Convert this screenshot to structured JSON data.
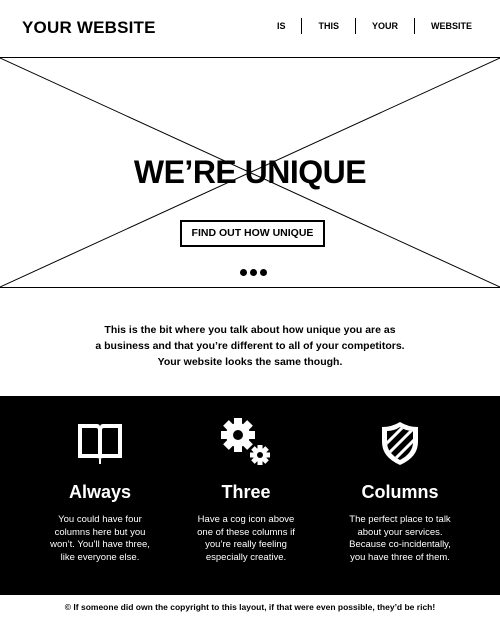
{
  "header": {
    "logo": "YOUR WEBSITE",
    "nav": [
      "IS",
      "THIS",
      "YOUR",
      "WEBSITE"
    ]
  },
  "hero": {
    "title": "WE’RE UNIQUE",
    "cta": "FIND OUT HOW UNIQUE",
    "slide_dots": 3
  },
  "intro": {
    "lines": [
      "This is the bit where you talk about how unique you are as",
      "a business and that you’re different to all of your competitors.",
      "Your website looks the same though."
    ]
  },
  "features": {
    "background": "#000000",
    "columns": [
      {
        "icon": "book-icon",
        "title": "Always",
        "lines": [
          "You could have four",
          "columns here but you",
          "won’t. You’ll have three,",
          "like everyone else."
        ]
      },
      {
        "icon": "cogs-icon",
        "title": "Three",
        "lines": [
          "Have a cog icon above",
          "one of these columns if",
          "you’re really feeling",
          "especially creative."
        ]
      },
      {
        "icon": "shield-icon",
        "title": "Columns",
        "lines": [
          "The perfect place to talk",
          "about your services.",
          "Because co-incidentally,",
          "you have three of them."
        ]
      }
    ]
  },
  "footer": {
    "copyright": "© If someone did own the copyright to this layout, if that were even possible, they’d be rich!"
  }
}
